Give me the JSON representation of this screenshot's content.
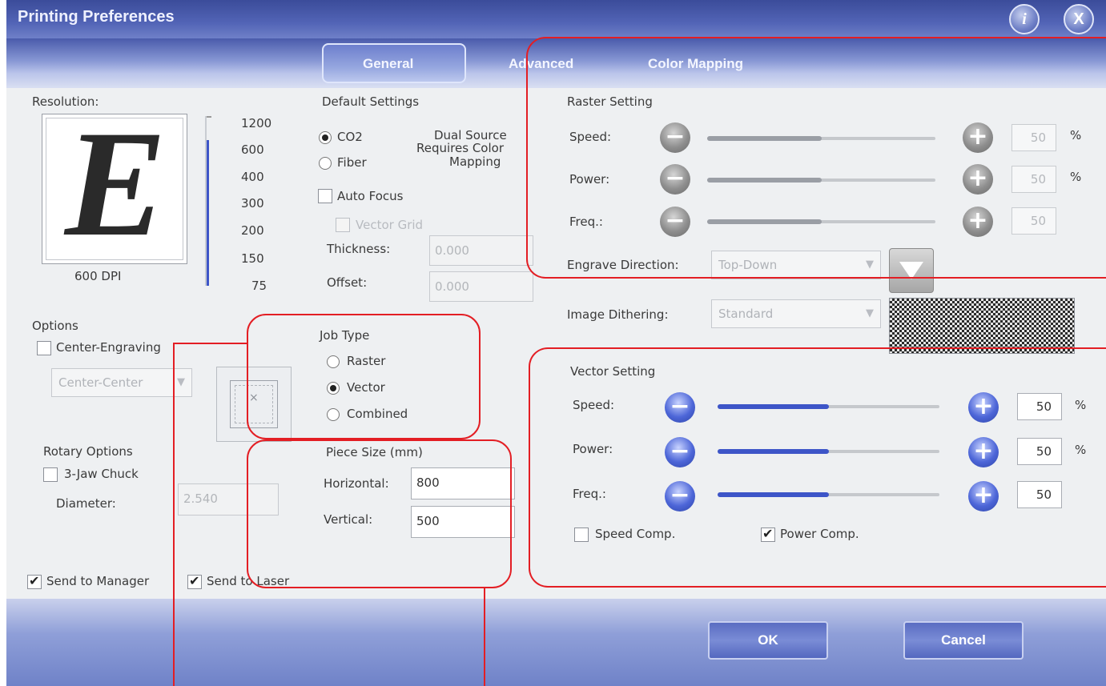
{
  "window": {
    "title": "Printing Preferences",
    "info_glyph": "i",
    "close_glyph": "X"
  },
  "tabs": [
    {
      "label": "General",
      "active": true
    },
    {
      "label": "Advanced",
      "active": false
    },
    {
      "label": "Color Mapping",
      "active": false
    }
  ],
  "resolution": {
    "label": "Resolution:",
    "preview_letter": "E",
    "dpi_label": "600 DPI",
    "values": [
      "1200",
      "600",
      "400",
      "300",
      "200",
      "150",
      "75"
    ]
  },
  "default_settings": {
    "header": "Default Settings",
    "co2_label": "CO2",
    "fiber_label": "Fiber",
    "source_selected": "CO2",
    "dual_source_note": [
      "Dual Source",
      "Requires Color",
      "Mapping"
    ],
    "auto_focus_label": "Auto Focus",
    "vector_grid_label": "Vector Grid",
    "thickness_label": "Thickness:",
    "thickness_value": "0.000",
    "offset_label": "Offset:",
    "offset_value": "0.000"
  },
  "options": {
    "header": "Options",
    "center_engraving_label": "Center-Engraving",
    "center_select_value": "Center-Center"
  },
  "rotary": {
    "header": "Rotary Options",
    "chuck_label": "3-Jaw Chuck",
    "diameter_label": "Diameter:",
    "diameter_value": "2.540"
  },
  "job_type": {
    "header": "Job Type",
    "raster_label": "Raster",
    "vector_label": "Vector",
    "combined_label": "Combined",
    "selected": "Vector"
  },
  "piece_size": {
    "header": "Piece Size (mm)",
    "horizontal_label": "Horizontal:",
    "horizontal_value": "800",
    "vertical_label": "Vertical:",
    "vertical_value": "500"
  },
  "send": {
    "manager_label": "Send to Manager",
    "laser_label": "Send to Laser",
    "manager_checked": true,
    "laser_checked": true
  },
  "raster": {
    "header": "Raster Setting",
    "speed_label": "Speed:",
    "speed_value": "50",
    "speed_unit": "%",
    "speed_level": 0.5,
    "power_label": "Power:",
    "power_value": "50",
    "power_unit": "%",
    "power_level": 0.5,
    "freq_label": "Freq.:",
    "freq_value": "50",
    "freq_level": 0.5,
    "engrave_direction_label": "Engrave Direction:",
    "engrave_direction_value": "Top-Down"
  },
  "dithering": {
    "label": "Image Dithering:",
    "value": "Standard"
  },
  "vector": {
    "header": "Vector Setting",
    "speed_label": "Speed:",
    "speed_value": "50",
    "speed_unit": "%",
    "speed_level": 0.5,
    "power_label": "Power:",
    "power_value": "50",
    "power_unit": "%",
    "power_level": 0.5,
    "freq_label": "Freq.:",
    "freq_value": "50",
    "freq_level": 0.5,
    "speed_comp_label": "Speed Comp.",
    "power_comp_label": "Power Comp.",
    "speed_comp_checked": false,
    "power_comp_checked": true
  },
  "footer": {
    "ok_label": "OK",
    "cancel_label": "Cancel"
  },
  "colors": {
    "annotation_red": "#e31e24",
    "title_blue": "#4a5bab",
    "slider_blue": "#3d55c8"
  }
}
